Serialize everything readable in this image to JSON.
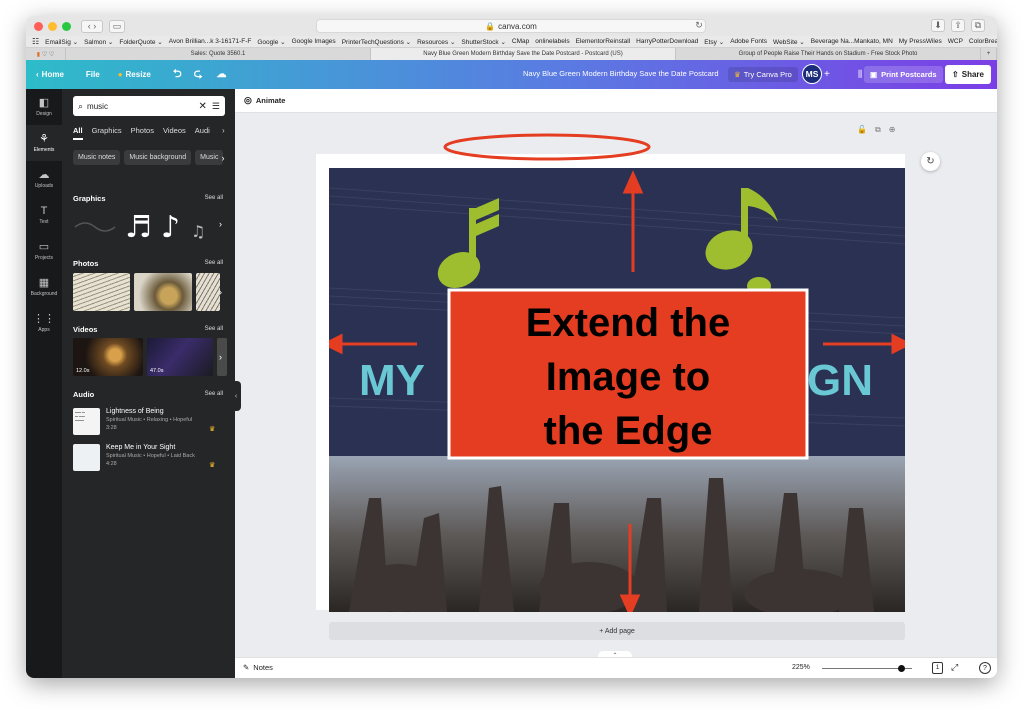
{
  "browser": {
    "url": "canva.com",
    "bookmarks": [
      "EmailSig ⌄",
      "Salmon ⌄",
      "FolderQuote ⌄",
      "Avon Brillian...k 3-16171-F-F",
      "Google ⌄",
      "Google Images",
      "PrinterTechQuestions ⌄",
      "Resources ⌄",
      "ShutterStock ⌄",
      "CMap",
      "onlinelabels",
      "ElementorReinstall",
      "HarryPotterDownload",
      "Etsy ⌄",
      "Adobe Fonts",
      "WebSite ⌄",
      "Beverage Na...Mankato, MN",
      "My PressWiles",
      "WCP",
      "ColorBreakdownAdobe"
    ],
    "tabs": [
      "Sales: Quote 3560.1",
      "Navy Blue Green Modern Birthday Save the Date Postcard - Postcard (US)",
      "Group of People Raise Their Hands on Stadium - Free Stock Photo"
    ],
    "more": "»"
  },
  "header": {
    "home": "Home",
    "file": "File",
    "resize": "Resize",
    "title": "Navy Blue Green Modern Birthday Save the Date Postcard",
    "try_pro": "Try Canva Pro",
    "avatar": "MS",
    "plus": "+",
    "print": "Print Postcards",
    "share": "Share"
  },
  "leftnav": [
    {
      "icon": "design-icon",
      "label": "Design"
    },
    {
      "icon": "elements-icon",
      "label": "Elements"
    },
    {
      "icon": "uploads-icon",
      "label": "Uploads"
    },
    {
      "icon": "text-icon",
      "label": "Text"
    },
    {
      "icon": "projects-icon",
      "label": "Projects"
    },
    {
      "icon": "background-icon",
      "label": "Background"
    },
    {
      "icon": "apps-icon",
      "label": "Apps"
    }
  ],
  "panel": {
    "search_value": "music",
    "tabs": [
      "All",
      "Graphics",
      "Photos",
      "Videos",
      "Audi"
    ],
    "chips": [
      "Music notes",
      "Music background",
      "Music"
    ],
    "graphics_title": "Graphics",
    "photos_title": "Photos",
    "videos_title": "Videos",
    "audio_title": "Audio",
    "see_all": "See all",
    "video_durations": [
      "12.0s",
      "47.0s"
    ],
    "audio": [
      {
        "title": "Lightness of Being",
        "meta": "Spiritual Music • Relaxing • Hopeful",
        "duration": "3:28"
      },
      {
        "title": "Keep Me in Your Sight",
        "meta": "Spiritual Music • Hopeful • Laid Back",
        "duration": "4:28"
      }
    ]
  },
  "editor": {
    "animate": "Animate",
    "add_page": "+ Add page",
    "notes": "Notes",
    "zoom": "225%",
    "page_number": "1",
    "help": "?"
  },
  "canvas": {
    "headline_left": "MY",
    "headline_right": "GN",
    "overlay_lines": [
      "Extend the",
      "Image to",
      "the Edge"
    ],
    "colors": {
      "navy": "#2b3152",
      "green": "#9ebe2f",
      "teal": "#6ac8d4",
      "red": "#e43d21"
    }
  }
}
